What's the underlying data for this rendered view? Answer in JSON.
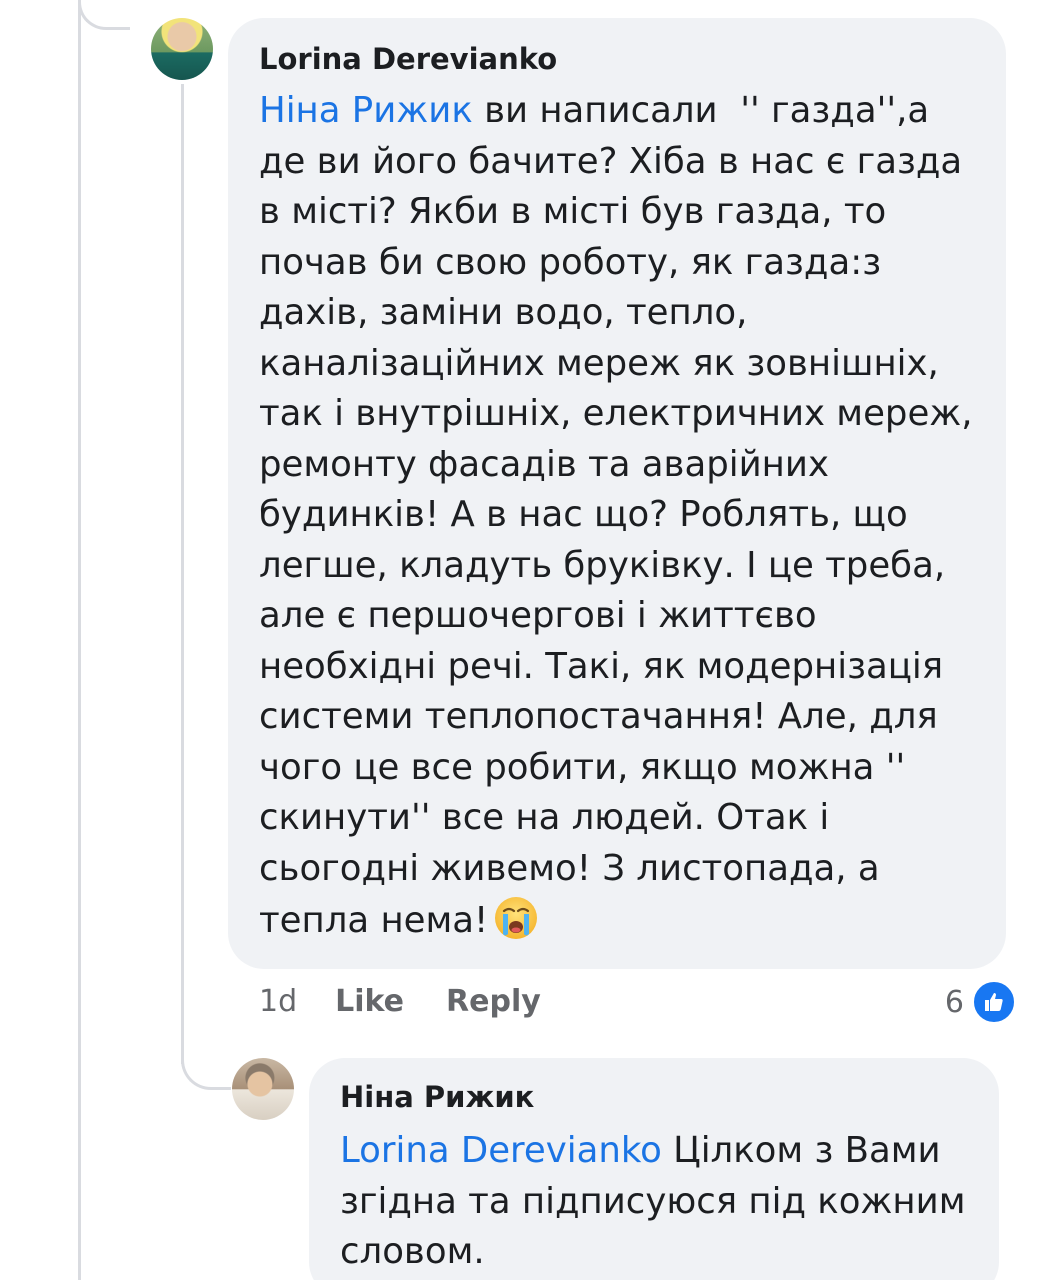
{
  "comment": {
    "author": "Lorina Derevianko",
    "mention": "Ніна Рижик",
    "text": " ви написали  '' газда'',а де ви його бачите? Хіба в нас є газда в місті? Якби в місті був газда, то почав би свою роботу, як газда:з дахів, заміни водо, тепло, каналізаційних мереж як зовнішніх, так і внутрішніх, електричних мереж, ремонту фасадів та аварійних будинків! А в нас що? Роблять, що легше, кладуть бруківку. І це треба, але є першочергові і життєво необхідні речі. Такі, як модернізація системи теплопостачання! Але, для чого це все робити, якщо можна '' скинути'' все на людей. Отак і сьогодні живемо! З листопада, а тепла нема!",
    "emoji_icon": "loudly-crying-face",
    "time": "1d",
    "like_label": "Like",
    "reply_label": "Reply",
    "reaction_count": "6",
    "reaction_icon": "like-thumb"
  },
  "reply": {
    "author": "Ніна Рижик",
    "mention": "Lorina Derevianko",
    "text": " Цілком з Вами згідна та підписуюся під кожним словом."
  },
  "colors": {
    "bubble": "#f0f2f5",
    "mention": "#1b74e4",
    "like": "#1877f2",
    "meta": "#65676b"
  }
}
